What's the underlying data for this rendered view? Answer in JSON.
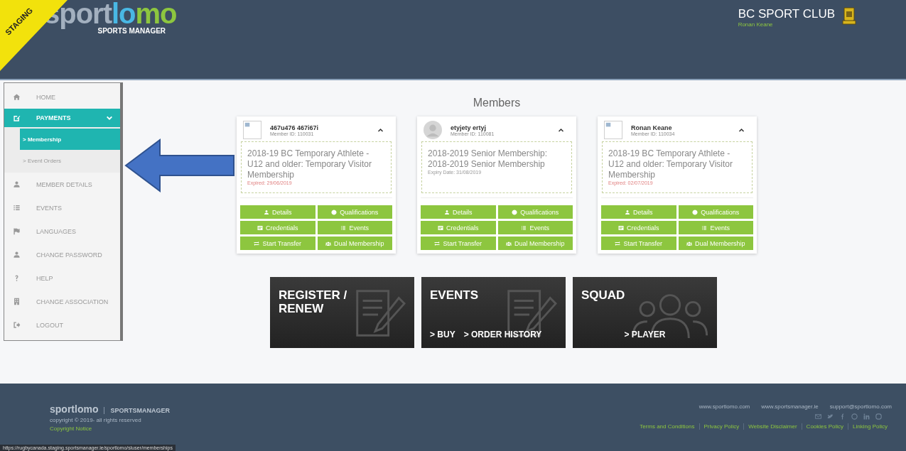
{
  "banner": {
    "text": "STAGING"
  },
  "logo": {
    "part1": "sport",
    "part2": "lo",
    "part3": "mo",
    "subtitle": "SPORTS MANAGER"
  },
  "club": {
    "name": "BC SPORT CLUB",
    "user": "Ronan Keane"
  },
  "sidebar": {
    "items": [
      {
        "kind": "home",
        "label": "HOME",
        "selected": false
      },
      {
        "kind": "edit",
        "label": "PAYMENTS",
        "selected": true,
        "expanded": true,
        "children": [
          {
            "label": "> Membership",
            "selected": true
          },
          {
            "label": "> Event Orders",
            "selected": false
          }
        ]
      },
      {
        "kind": "user",
        "label": "MEMBER DETAILS",
        "selected": false
      },
      {
        "kind": "list",
        "label": "EVENTS",
        "selected": false
      },
      {
        "kind": "flag",
        "label": "LANGUAGES",
        "selected": false
      },
      {
        "kind": "user",
        "label": "CHANGE PASSWORD",
        "selected": false
      },
      {
        "kind": "help",
        "label": "HELP",
        "selected": false
      },
      {
        "kind": "building",
        "label": "CHANGE ASSOCIATION",
        "selected": false
      },
      {
        "kind": "logout",
        "label": "LOGOUT",
        "selected": false
      }
    ]
  },
  "page_title": "Members",
  "members": [
    {
      "kind": "broken-image",
      "name": "467u476 467i67i",
      "member_id": "Member ID: 110031",
      "membership": "2018-19 BC Temporary Athlete - U12 and older: Temporary Visitor Membership",
      "status": "Expired: 29/06/2019",
      "expired": true,
      "buttons": [
        {
          "kind": "user",
          "label": "Details"
        },
        {
          "kind": "circle",
          "label": "Qualifications"
        },
        {
          "kind": "card",
          "label": "Credentials"
        },
        {
          "kind": "list",
          "label": "Events"
        },
        {
          "kind": "transfer",
          "label": "Start Transfer"
        },
        {
          "kind": "group",
          "label": "Dual Membership"
        }
      ]
    },
    {
      "kind": "person",
      "name": "etyjety ertyj",
      "member_id": "Member ID: 110081",
      "membership": "2018-2019 Senior Membership: 2018-2019 Senior Membership",
      "status": "Expiry Date: 31/08/2019",
      "expired": false,
      "buttons": [
        {
          "kind": "user",
          "label": "Details"
        },
        {
          "kind": "circle",
          "label": "Qualifications"
        },
        {
          "kind": "card",
          "label": "Credentials"
        },
        {
          "kind": "list",
          "label": "Events"
        },
        {
          "kind": "transfer",
          "label": "Start Transfer"
        },
        {
          "kind": "group",
          "label": "Dual Membership"
        }
      ]
    },
    {
      "kind": "broken-image",
      "name": "Ronan Keane",
      "member_id": "Member ID: 110034",
      "membership": "2018-19 BC Temporary Athlete - U12 and older: Temporary Visitor Membership",
      "status": "Expired: 02/07/2019",
      "expired": true,
      "buttons": [
        {
          "kind": "user",
          "label": "Details"
        },
        {
          "kind": "circle",
          "label": "Qualifications"
        },
        {
          "kind": "card",
          "label": "Credentials"
        },
        {
          "kind": "list",
          "label": "Events"
        },
        {
          "kind": "transfer",
          "label": "Start Transfer"
        },
        {
          "kind": "group",
          "label": "Dual Membership"
        }
      ]
    }
  ],
  "tiles": [
    {
      "kind": "document",
      "title": "REGISTER / RENEW"
    },
    {
      "kind": "document",
      "title": "EVENTS",
      "links": [
        "> BUY",
        "> ORDER HISTORY"
      ]
    },
    {
      "kind": "people",
      "title": "SQUAD",
      "links": [
        "> PLAYER"
      ]
    }
  ],
  "footer": {
    "brand": "sportlomo",
    "product": "SPORTSMANAGER",
    "copyright": "copyright © 2019- all rights reserved",
    "notice": "Copyright Notice",
    "contacts": [
      "www.sportlomo.com",
      "www.sportsmanager.ie",
      "support@sportlomo.com"
    ],
    "policies": [
      "Terms and Conditions",
      "Privacy Policy",
      "Website Disclaimer",
      "Cookies Policy",
      "Linking Policy"
    ]
  },
  "status_url": "https://rugbycanada.staging.sportsmanager.ie/sportlomo/sluser/memberships"
}
